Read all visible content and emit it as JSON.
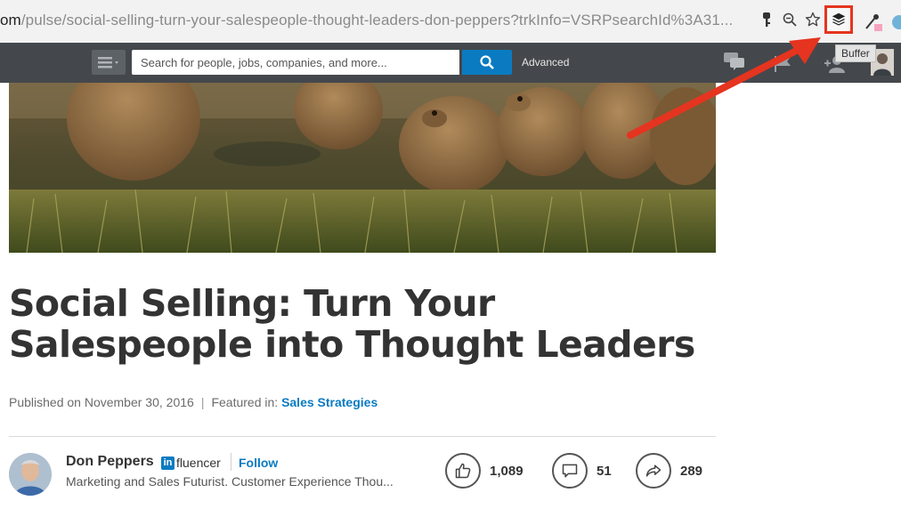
{
  "browser": {
    "url_prefix": "om",
    "url_rest": "/pulse/social-selling-turn-your-salespeople-thought-leaders-don-peppers?trkInfo=VSRPsearchId%3A31...",
    "buffer_tooltip": "Buffer",
    "highlight_color": "#e5341f"
  },
  "nav": {
    "search_placeholder": "Search for people, jobs, companies, and more...",
    "advanced_label": "Advanced"
  },
  "article": {
    "title": "Social Selling: Turn Your Salespeople into Thought Leaders",
    "published": "Published on November 30, 2016",
    "featured_label": "Featured in:",
    "featured_link": "Sales Strategies",
    "author": {
      "name": "Don Peppers",
      "badge_text": "in",
      "badge_suffix": "fluencer",
      "follow_label": "Follow",
      "headline": "Marketing and Sales Futurist. Customer Experience Thou..."
    },
    "social": {
      "likes": "1,089",
      "comments": "51",
      "shares": "289"
    }
  },
  "colors": {
    "linkedin_blue": "#0a7bc1",
    "nav_bg": "#44484c"
  }
}
